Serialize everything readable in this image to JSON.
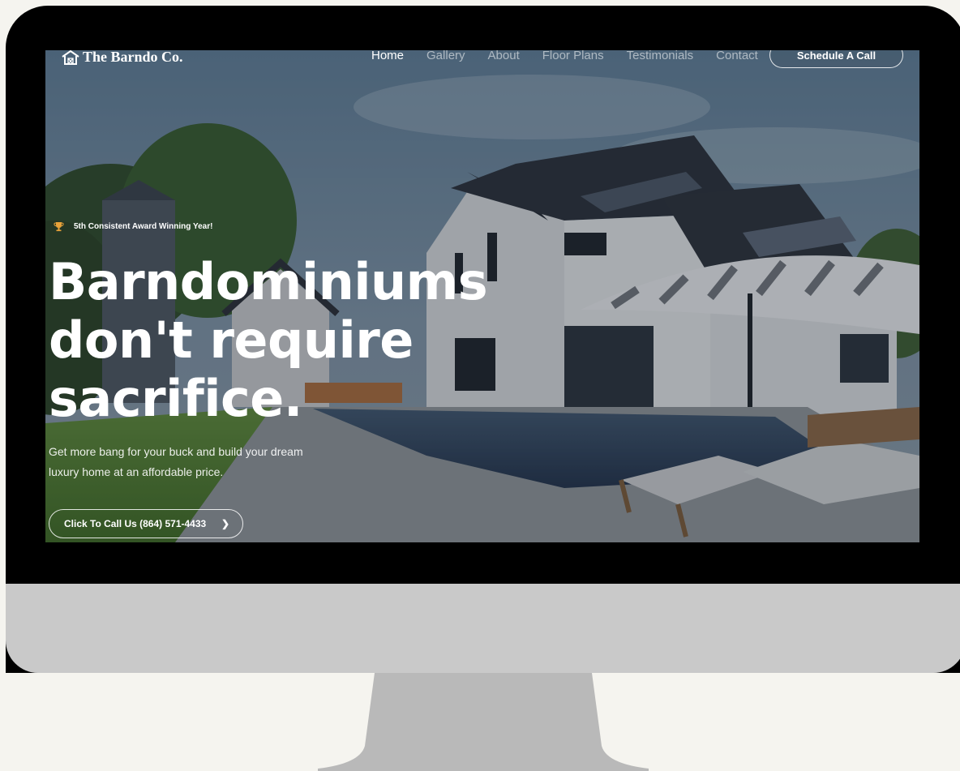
{
  "nav": {
    "logo_text": "The Barndo Co.",
    "links": [
      {
        "label": "Home",
        "active": true
      },
      {
        "label": "Gallery"
      },
      {
        "label": "About"
      },
      {
        "label": "Floor Plans"
      },
      {
        "label": "Testimonials"
      },
      {
        "label": "Contact"
      }
    ],
    "cta_label": "Schedule A Call"
  },
  "hero": {
    "award_text": "5th Consistent Award Winning Year!",
    "headline_line1": "Barndominiums",
    "headline_line2": "don't require",
    "headline_line3": "sacrifice.",
    "subtext_line1": "Get more bang for your buck and build your dream",
    "subtext_line2": "luxury home at an affordable price.",
    "call_button_label": "Click To Call Us (864) 571-4433"
  },
  "icons": {
    "logo": "barn-house-icon",
    "award": "trophy-icon",
    "call_arrow": "chevron-right-icon"
  },
  "colors": {
    "monitor_frame": "#000000",
    "monitor_chin": "#c9c9c9",
    "stand": "#b9b9b9",
    "page_background": "#f5f4ef",
    "trophy": "#e8a23a"
  }
}
